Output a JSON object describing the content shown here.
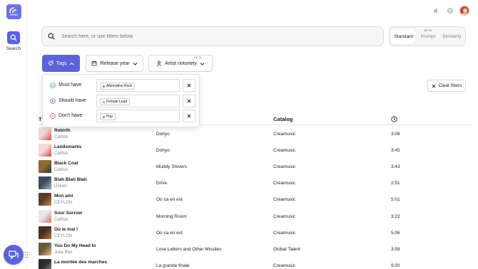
{
  "app": {
    "logo_text": "SYNC"
  },
  "rail": {
    "search_label": "Search"
  },
  "search": {
    "placeholder": "Search here, or use filters below"
  },
  "modes": [
    {
      "label": "Standard",
      "badge": "",
      "active": true
    },
    {
      "label": "Prompt",
      "badge": "BETA",
      "active": false
    },
    {
      "label": "Similarity",
      "badge": "",
      "active": false
    }
  ],
  "filters": {
    "tags_label": "Tags",
    "release_year_label": "Release year",
    "artist_notoriety_label": "Artist notoriety",
    "artist_notoriety_badge": "BETA"
  },
  "tag_rules": [
    {
      "label": "Must have",
      "chip": "Alternative Rock",
      "chip_color": "#3aa37a",
      "icon_color": "#3aa37a"
    },
    {
      "label": "Should have",
      "chip": "Female Lead",
      "chip_color": "#e39a2e",
      "icon_color": "#5a63d8"
    },
    {
      "label": "Don't have",
      "chip": "Pop",
      "chip_color": "#4a8fe0",
      "icon_color": "#d9534f"
    }
  ],
  "clear_filters_label": "Clear filters",
  "table": {
    "headers": {
      "title": "T",
      "catalog": "Catalog"
    },
    "rows": [
      {
        "title": "Rebirth",
        "artist": "Catfish",
        "album": "Dohyo",
        "catalog": "Creamusic",
        "duration": "3:06",
        "thumb_a": "#f4d9d9",
        "thumb_b": "#c94c4c"
      },
      {
        "title": "Landsmarks",
        "artist": "Catfish",
        "album": "Dohyo",
        "catalog": "Creamusic",
        "duration": "3:45",
        "thumb_a": "#f4d9d9",
        "thumb_b": "#c94c4c"
      },
      {
        "title": "Black Coat",
        "artist": "Catfish",
        "album": "Muddy Shivers",
        "catalog": "Creamusic",
        "duration": "3:43",
        "thumb_a": "#8a6a3a",
        "thumb_b": "#2e3a2a"
      },
      {
        "title": "Blah Blah Blah",
        "artist": "Usken",
        "album": "Drive",
        "catalog": "Creamusic",
        "duration": "2:51",
        "thumb_a": "#3a4a5c",
        "thumb_b": "#a8b4c0"
      },
      {
        "title": "Mon ami",
        "artist": "CEYLON",
        "album": "Où ca en est",
        "catalog": "Creamusic",
        "duration": "5:01",
        "thumb_a": "#5a3a2a",
        "thumb_b": "#c08a4a"
      },
      {
        "title": "Sour Sorrow",
        "artist": "Catfish",
        "album": "Morning Room",
        "catalog": "Creamusic",
        "duration": "3:22",
        "thumb_a": "#e8e8e8",
        "thumb_b": "#d4706a"
      },
      {
        "title": "Où le mal l",
        "artist": "CEYLON",
        "album": "Où ca en est",
        "catalog": "Creamusic",
        "duration": "5:06",
        "thumb_a": "#4a2e22",
        "thumb_b": "#b07a42"
      },
      {
        "title": "You Do My Head In",
        "artist": "Julia Biel",
        "album": "Love Letters and Other Missiles",
        "catalog": "Global Talent",
        "duration": "3:59",
        "thumb_a": "#6a5a3a",
        "thumb_b": "#d8c08a"
      },
      {
        "title": "La montée des marches",
        "artist": "",
        "album": "La grande finale",
        "catalog": "Creamusic",
        "duration": "9:20",
        "thumb_a": "#2a2a2a",
        "thumb_b": "#8a8a8a"
      }
    ]
  }
}
